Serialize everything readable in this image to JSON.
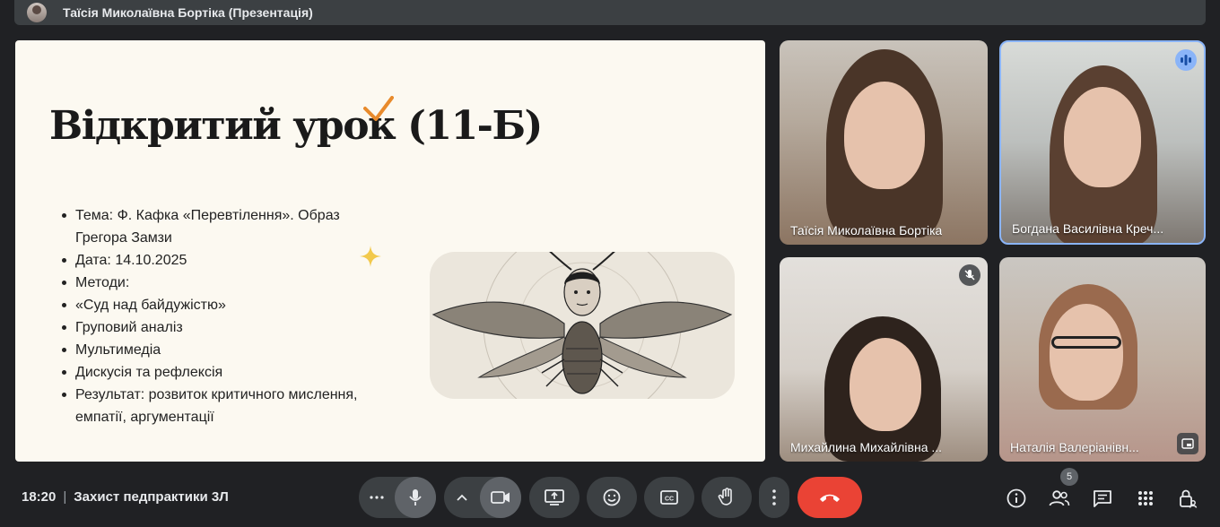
{
  "presenter_bar": {
    "label": "Таїсія Миколаївна Бортіка (Презентація)"
  },
  "slide": {
    "title": "Відкритий урок (11-Б)",
    "bullets": [
      "Тема: Ф. Кафка «Перевтілення». Образ Грегора Замзи",
      "Дата: 14.10.2025",
      "Методи:",
      "«Суд над байдужістю»",
      "Груповий аналіз",
      "Мультимедіа",
      "Дискусія та рефлексія",
      "Результат: розвиток критичного мислення, емпатії, аргументації"
    ],
    "accent_color": "#e88a2c",
    "sparkle_color": "#f2c94c"
  },
  "participants": [
    {
      "name": "Таїсія Миколаївна Бортіка",
      "status": ""
    },
    {
      "name": "Богдана Василівна Креч...",
      "status": "speaking"
    },
    {
      "name": "Михайлина Михайлівна ...",
      "status": "muted"
    },
    {
      "name": "Наталія Валеріанівн...",
      "status": "pinned"
    }
  ],
  "meeting": {
    "time": "18:20",
    "separator": "|",
    "title": "Захист педпрактики 3Л"
  },
  "people_count": "5",
  "colors": {
    "background": "#202124",
    "control": "#3c4043",
    "end_call": "#ea4335",
    "speaking_outline": "#8ab4f8"
  },
  "icons": [
    "more-horiz-icon",
    "mic-icon",
    "chevron-up-icon",
    "camera-icon",
    "present-screen-icon",
    "emoji-icon",
    "captions-icon",
    "raise-hand-icon",
    "more-vert-icon",
    "end-call-icon",
    "info-icon",
    "people-icon",
    "chat-icon",
    "activities-icon",
    "host-controls-icon"
  ]
}
